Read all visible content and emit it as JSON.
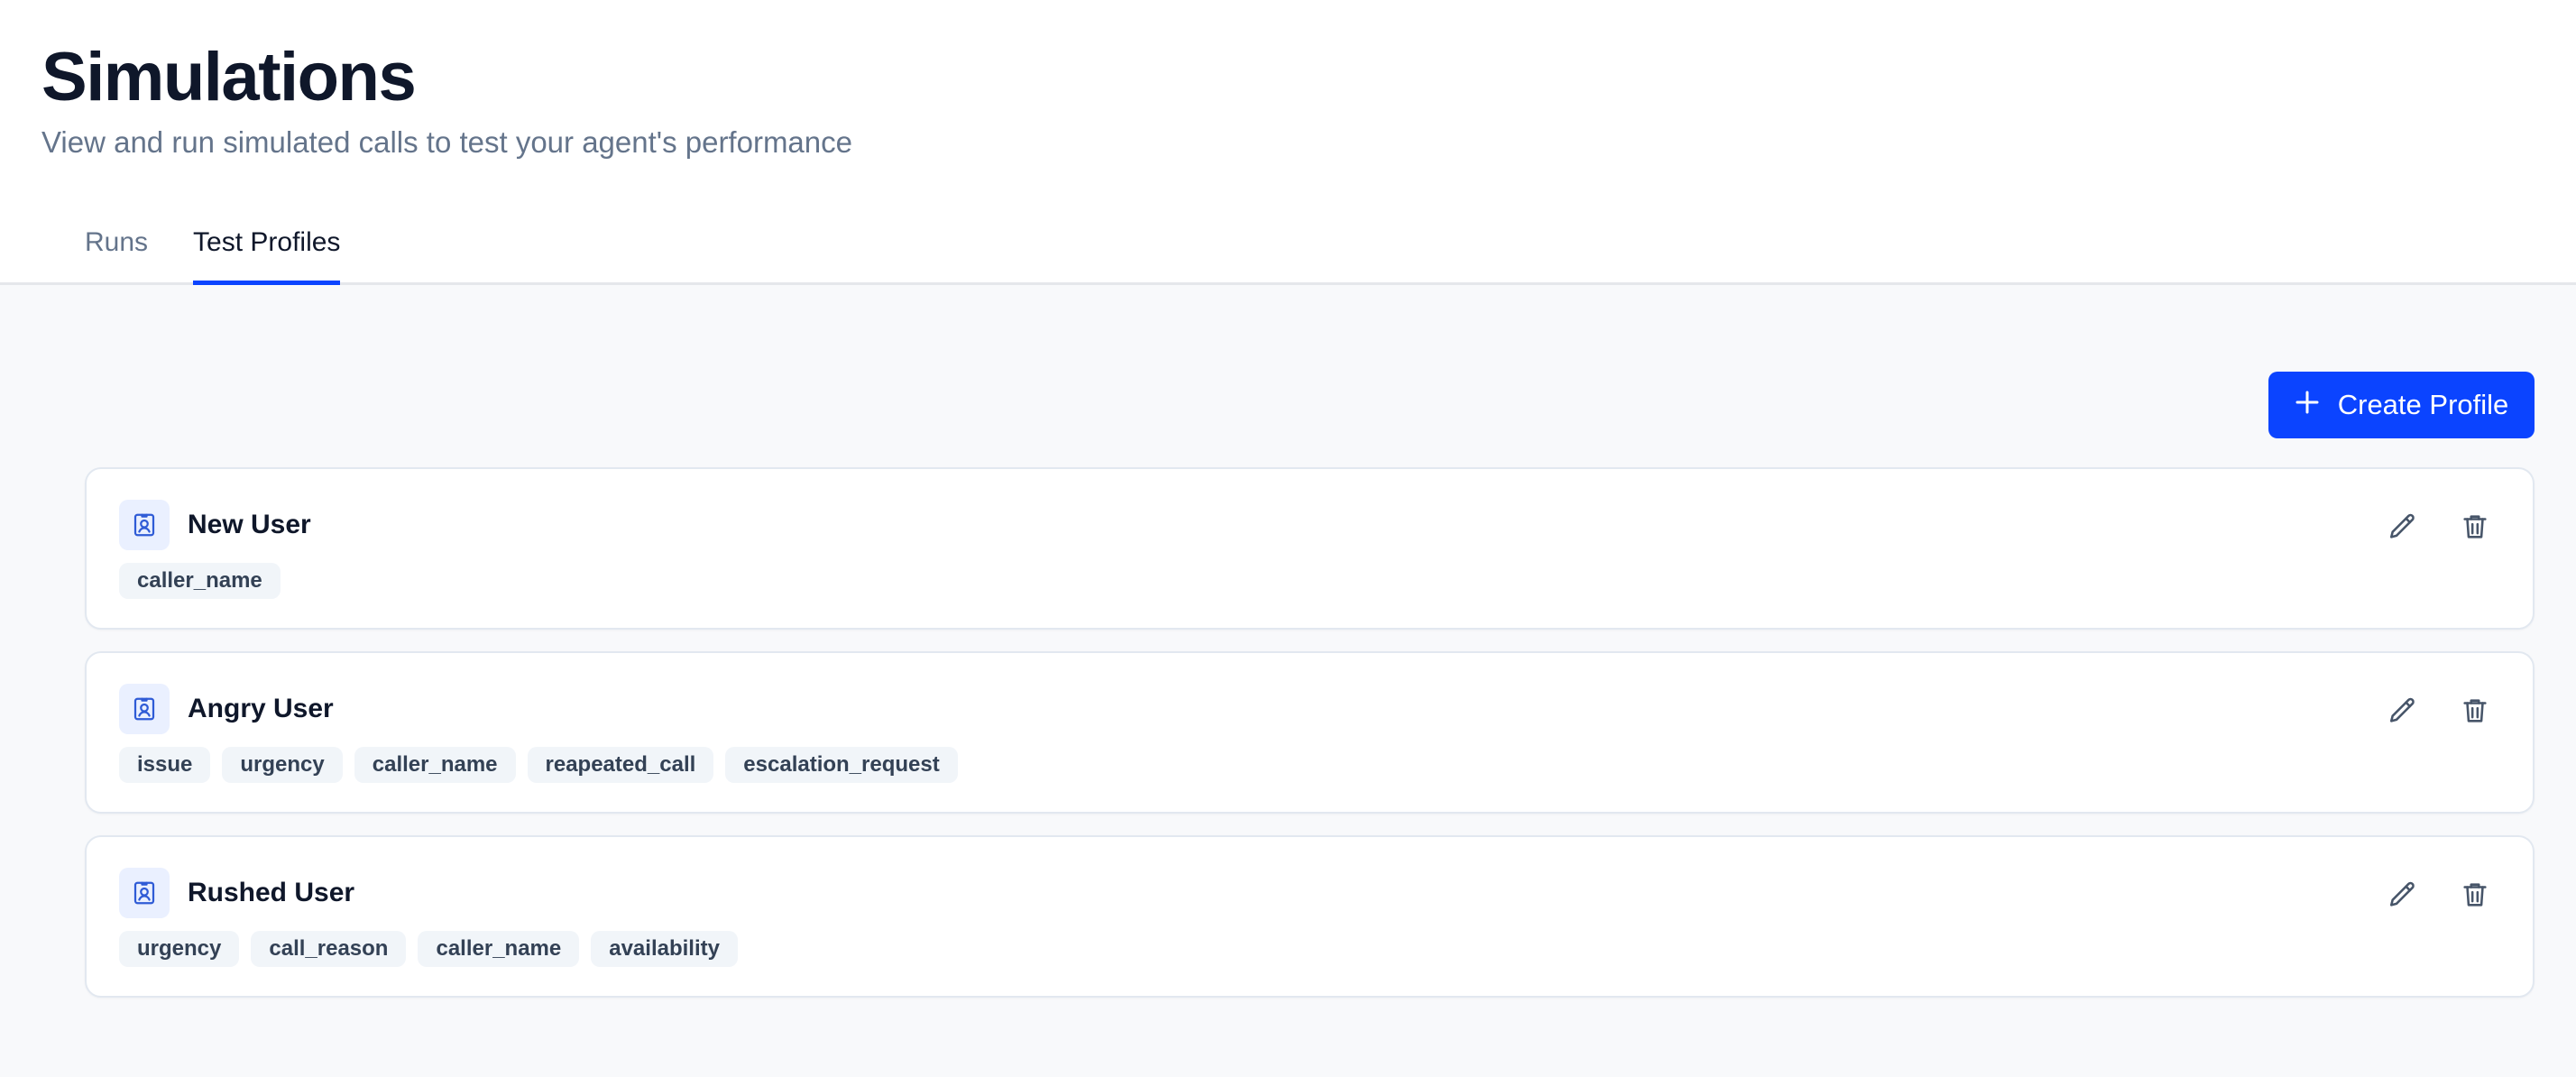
{
  "header": {
    "title": "Simulations",
    "subtitle": "View and run simulated calls to test your agent's performance"
  },
  "tabs": [
    {
      "label": "Runs",
      "active": false
    },
    {
      "label": "Test Profiles",
      "active": true
    }
  ],
  "toolbar": {
    "create_label": "Create Profile",
    "create_icon": "plus-icon"
  },
  "profiles": [
    {
      "name": "New User",
      "icon": "contact-card-icon",
      "tags": [
        "caller_name"
      ]
    },
    {
      "name": "Angry User",
      "icon": "contact-card-icon",
      "tags": [
        "issue",
        "urgency",
        "caller_name",
        "reapeated_call",
        "escalation_request"
      ]
    },
    {
      "name": "Rushed User",
      "icon": "contact-card-icon",
      "tags": [
        "urgency",
        "call_reason",
        "caller_name",
        "availability"
      ]
    }
  ],
  "colors": {
    "accent": "#0b44ff",
    "text": "#0f172a",
    "muted": "#64748b",
    "tag_bg": "#f1f5f9",
    "icon_bg": "#eaf0ff"
  }
}
